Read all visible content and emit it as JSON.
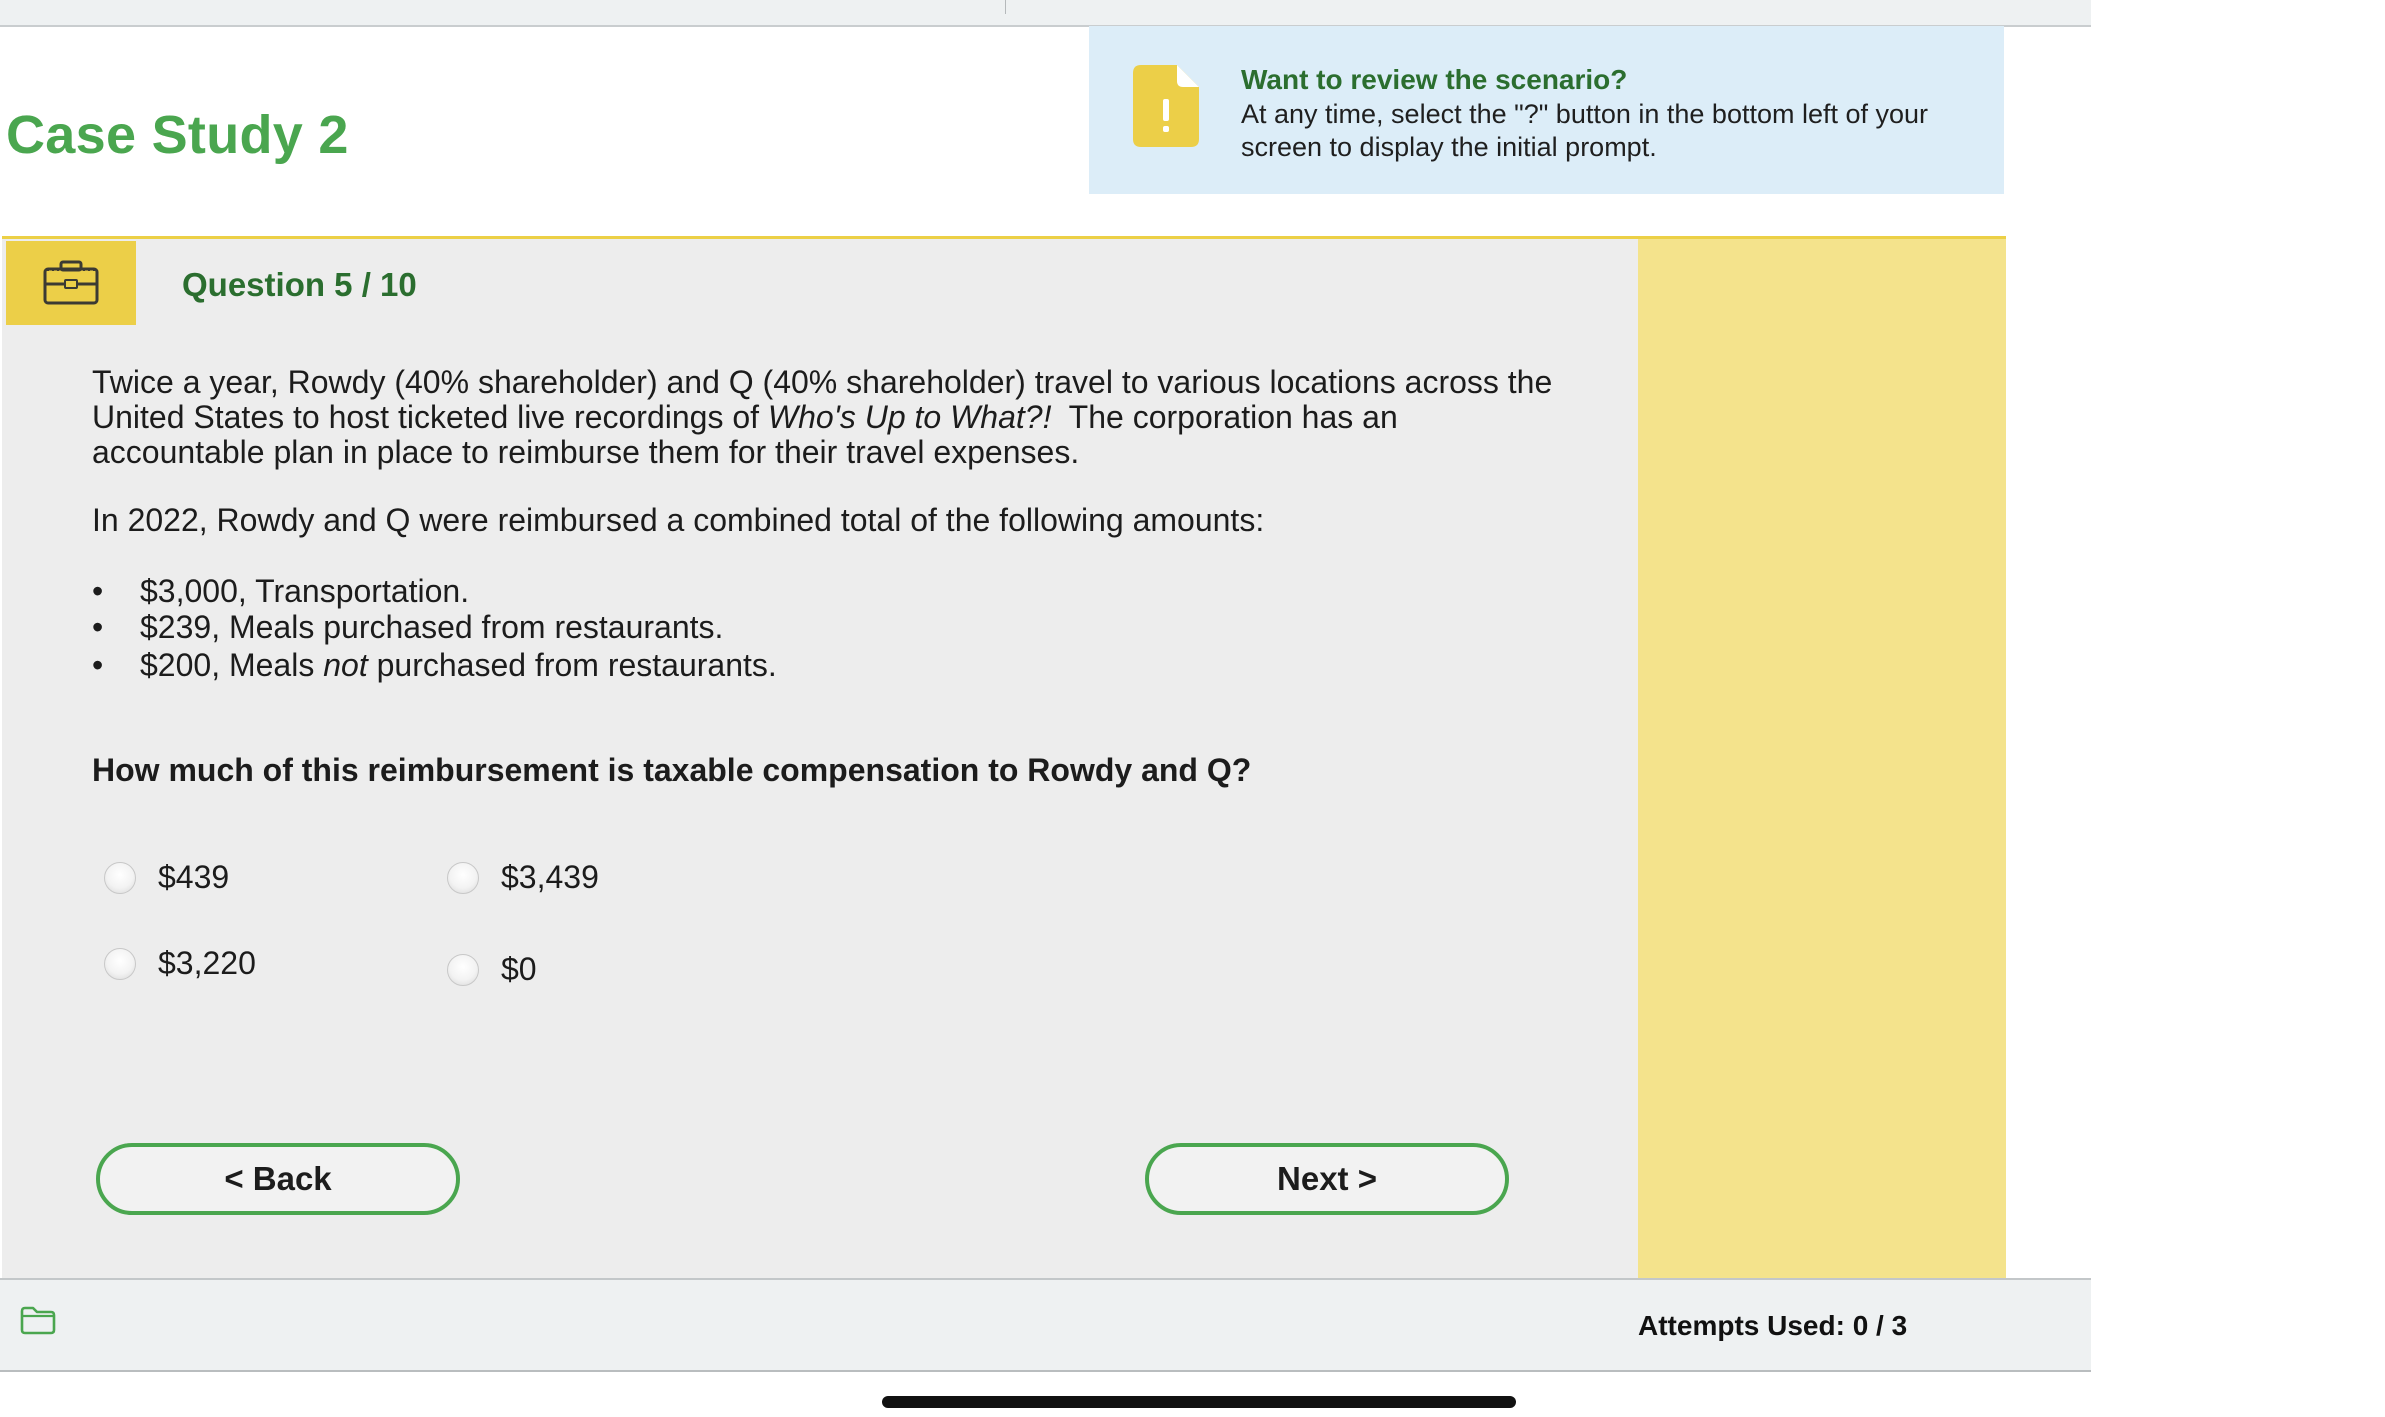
{
  "header": {
    "title": "Case Study 2"
  },
  "info_banner": {
    "icon": "document-alert-icon",
    "title": "Want to review the scenario?",
    "body": "At any time, select the \"?\" button in the bottom left of your screen to display the initial prompt."
  },
  "question": {
    "icon": "briefcase-icon",
    "counter": "Question 5 / 10",
    "scenario_parts": [
      "Twice a year, Rowdy (40% shareholder) and Q (40% shareholder) travel to various locations across the United States to host ticketed live recordings of ",
      "Who's Up to What?!",
      "  The corporation has an accountable plan in place to reimburse them for their travel expenses."
    ],
    "intro": "In 2022, Rowdy and Q were reimbursed a combined total of the following amounts:",
    "bullet": "•",
    "expenses": [
      {
        "text": "$3,000, Transportation."
      },
      {
        "text": "$239, Meals purchased from restaurants."
      },
      {
        "before": "$200, Meals ",
        "emph": "not",
        "after": " purchased from restaurants."
      }
    ],
    "prompt": "How much of this reimbursement is taxable compensation to Rowdy and Q?",
    "options": [
      "$439",
      "$3,439",
      "$3,220",
      "$0"
    ]
  },
  "navigation": {
    "back_label": "< Back",
    "next_label": "Next >"
  },
  "footer": {
    "icon": "folder-icon",
    "attempts": "Attempts Used: 0 / 3"
  },
  "colors": {
    "title_green": "#4aa64f",
    "dark_green": "#2b6e2f",
    "banner_blue": "#dcedf8",
    "accent_yellow": "#eccf48",
    "side_panel_yellow": "#f4e38c",
    "panel_gray": "#ededed"
  }
}
